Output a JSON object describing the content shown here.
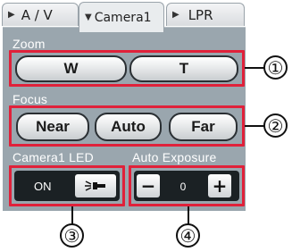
{
  "tabs": [
    {
      "label": "A / V"
    },
    {
      "label": "Camera1"
    },
    {
      "label": "LPR"
    }
  ],
  "zoom": {
    "label": "Zoom",
    "wide": "W",
    "tele": "T"
  },
  "focus": {
    "label": "Focus",
    "near": "Near",
    "auto": "Auto",
    "far": "Far"
  },
  "led": {
    "label": "Camera1 LED",
    "state": "ON"
  },
  "exposure": {
    "label": "Auto Exposure",
    "minus": "−",
    "value": "0",
    "plus": "+"
  },
  "callouts": [
    "①",
    "②",
    "③",
    "④"
  ],
  "colors": {
    "highlight": "#e0213a",
    "panel": "#9aa6ae",
    "dark_group": "#1b2124"
  }
}
